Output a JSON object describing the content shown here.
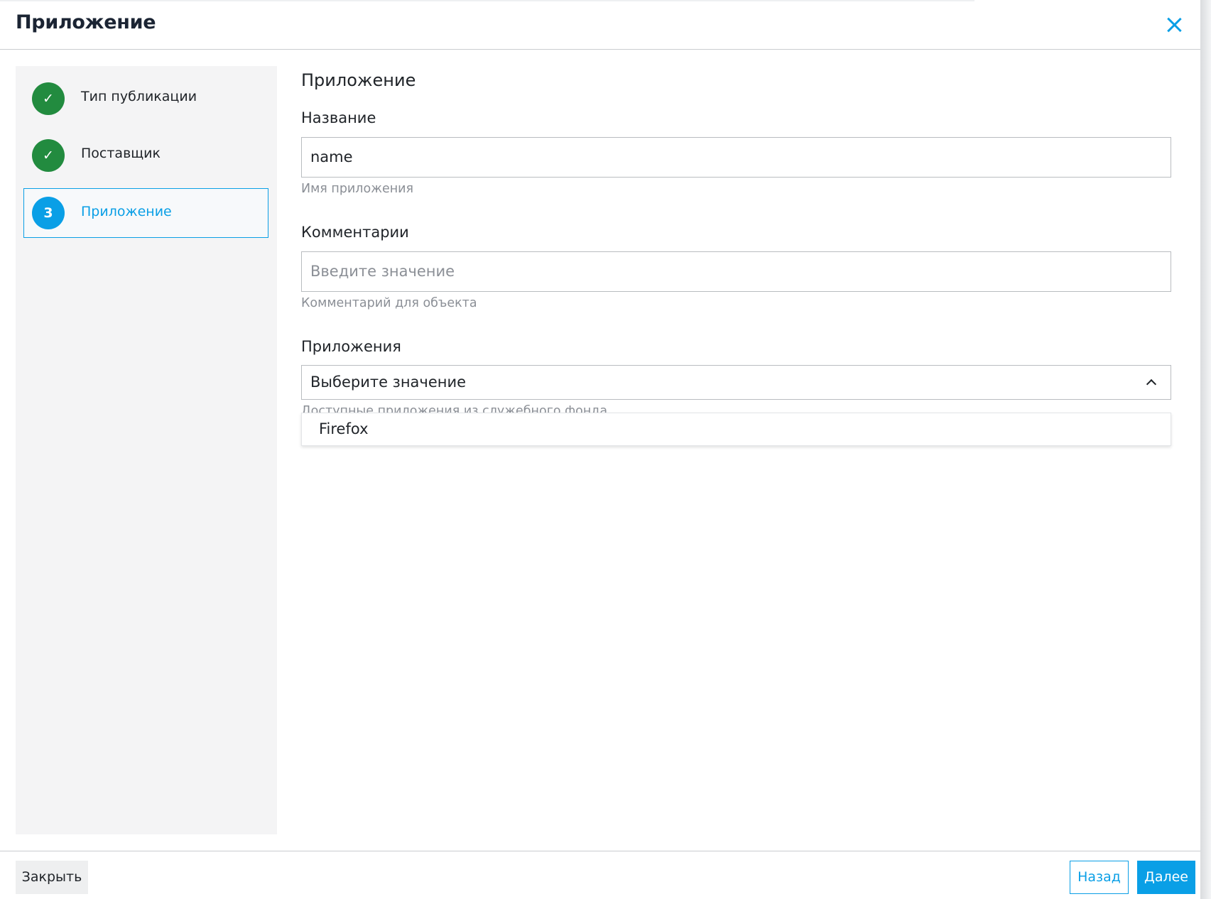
{
  "header": {
    "title": "Приложение"
  },
  "steps": [
    {
      "label": "Тип публикации",
      "marker": "✓",
      "state": "done"
    },
    {
      "label": "Поставщик",
      "marker": "✓",
      "state": "done"
    },
    {
      "label": "Приложение",
      "marker": "3",
      "state": "active"
    }
  ],
  "form": {
    "title": "Приложение",
    "name": {
      "label": "Название",
      "value": "name",
      "hint": "Имя приложения"
    },
    "comments": {
      "label": "Комментарии",
      "placeholder": "Введите значение",
      "hint": "Комментарий для объекта"
    },
    "apps": {
      "label": "Приложения",
      "placeholder": "Выберите значение",
      "hint": "Доступные приложения из служебного фонда",
      "options": [
        "Firefox"
      ]
    }
  },
  "footer": {
    "close_label": "Закрыть",
    "back_label": "Назад",
    "next_label": "Далее"
  },
  "colors": {
    "accent": "#0a9fe6",
    "done": "#228b3f",
    "sidebar_bg": "#f4f4f5"
  },
  "icons": {
    "close": "close-icon",
    "chevron": "chevron-up-icon",
    "check": "check-icon"
  }
}
